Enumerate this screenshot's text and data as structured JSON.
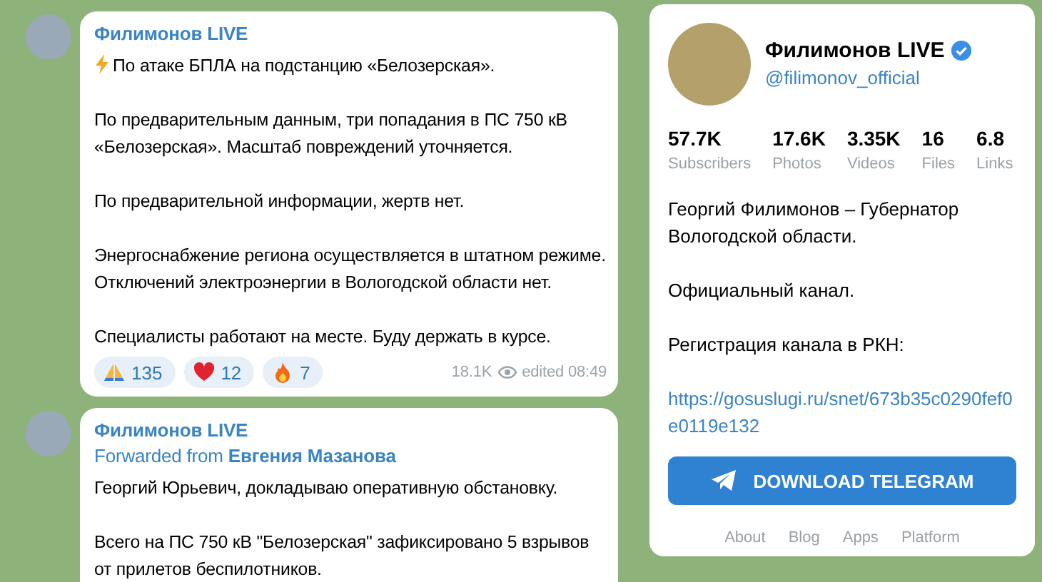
{
  "messages": [
    {
      "channel": "Филимонов LIVE",
      "paragraphs": [
        {
          "kind": "headline",
          "text": "По атаке БПЛА на подстанцию «Белозерская»."
        },
        {
          "text": "По предварительным данным, три попадания в ПС 750 кВ «Белозерская». Масштаб повреждений уточняется."
        },
        {
          "text": "По предварительной информации, жертв нет."
        },
        {
          "text": "Энергоснабжение региона осуществляется в штатном режиме. Отключений электроэнергии в Вологодской области нет."
        },
        {
          "text": "Специалисты работают на месте. Буду держать в курсе."
        }
      ],
      "reactions": [
        {
          "kind": "pray",
          "count": "135"
        },
        {
          "kind": "heart",
          "count": "12"
        },
        {
          "kind": "fire",
          "count": "7"
        }
      ],
      "views": "18.1K",
      "time": "edited 08:49"
    },
    {
      "channel": "Филимонов LIVE",
      "forwarded_label": "Forwarded from",
      "forwarded_from": "Евгения Мазанова",
      "paragraphs": [
        {
          "text": "Георгий Юрьевич, докладываю оперативную обстановку."
        },
        {
          "text": "Всего на ПС 750 кВ \"Белозерская\" зафиксировано 5 взрывов от прилетов беспилотников."
        }
      ]
    }
  ],
  "channel_card": {
    "name": "Филимонов LIVE",
    "verified": true,
    "username": "@filimonov_official",
    "stats": [
      {
        "value": "57.7K",
        "label": "Subscribers"
      },
      {
        "value": "17.6K",
        "label": "Photos"
      },
      {
        "value": "3.35K",
        "label": "Videos"
      },
      {
        "value": "16",
        "label": "Files"
      },
      {
        "value": "6.8",
        "label": "Links"
      }
    ],
    "description": [
      "Георгий Филимонов – Губернатор Вологодской области.",
      "Официальный канал.",
      "Регистрация канала в РКН:"
    ],
    "link": "https://gosuslugi.ru/snet/673b35c0290fef0e0119e132",
    "download_button": "DOWNLOAD TELEGRAM",
    "footer_links": [
      "About",
      "Blog",
      "Apps",
      "Platform"
    ]
  }
}
